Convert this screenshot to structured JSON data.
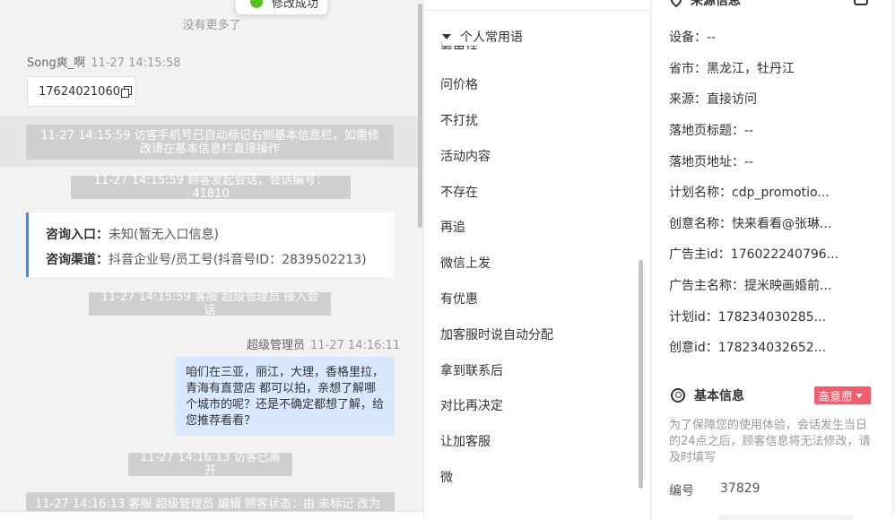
{
  "chat": {
    "toast": "修改成功",
    "no_more": "没有更多了",
    "visitor_name": "Song爽_啊",
    "visitor_time": "11-27 14:15:58",
    "phone": "17624021060",
    "sys_marked": "11-27 14:15:59 访客手机号已自动标记右侧基本信息栏，如需修改请在基本信息栏直接操作",
    "sys_started": "11-27 14:15:59 顾客发起会话，会话编号：41810",
    "entry_label": "咨询入口：",
    "entry_value": "未知(暂无入口信息)",
    "channel_label": "咨询渠道：",
    "channel_value": "抖音企业号/员工号(抖音号ID：2839502213)",
    "sys_accepted": "11-27 14:15:59 客服 超级管理员 接入会话",
    "agent_name": "超级管理员",
    "agent_time": "11-27 14:16:11",
    "agent_message": "咱们在三亚，丽江，大理，香格里拉，青海有直营店 都可以拍，亲想了解哪个城市的呢？还是不确定都想了解，给您推荐看看？",
    "sys_left": "11-27 14:16:13 访客已离开",
    "sys_edit": "11-27 14:16:13 客服 超级管理员 编辑 顾客状态：由 未标记 改为"
  },
  "phrases": {
    "header": "个人常用语",
    "partial_item": "要电话",
    "items": [
      "问价格",
      "不打扰",
      "活动内容",
      "不存在",
      "再追",
      "微信上发",
      "有优惠",
      "加客服时说自动分配",
      "拿到联系后",
      "对比再决定",
      "让加客服",
      "微"
    ]
  },
  "source": {
    "title": "来源信息",
    "fields": [
      {
        "label": "设备：",
        "value": "--"
      },
      {
        "label": "省市：",
        "value": "黑龙江，牡丹江"
      },
      {
        "label": "来源：",
        "value": "直接访问"
      },
      {
        "label": "落地页标题：",
        "value": "--"
      },
      {
        "label": "落地页地址：",
        "value": "--"
      },
      {
        "label": "计划名称：",
        "value": "cdp_promotio..."
      },
      {
        "label": "创意名称：",
        "value": "快来看看@张琳..."
      },
      {
        "label": "广告主id：",
        "value": "176022240796..."
      },
      {
        "label": "广告主名称：",
        "value": "提米映画婚前..."
      },
      {
        "label": "计划id：",
        "value": "178234030285..."
      },
      {
        "label": "创意id：",
        "value": "178234032652..."
      }
    ]
  },
  "basic": {
    "title": "基本信息",
    "intent": "高意愿",
    "notice": "为了保障您的使用体验，会话发生当日的24点之后，顾客信息将无法修改，请及时填写",
    "number_label": "编号",
    "number_value": "37829"
  },
  "colors": {
    "accent_blue": "#3a87f5",
    "intent_red": "#f05d6c",
    "success_green": "#52c41a",
    "bubble_blue": "#d8e8ff"
  }
}
